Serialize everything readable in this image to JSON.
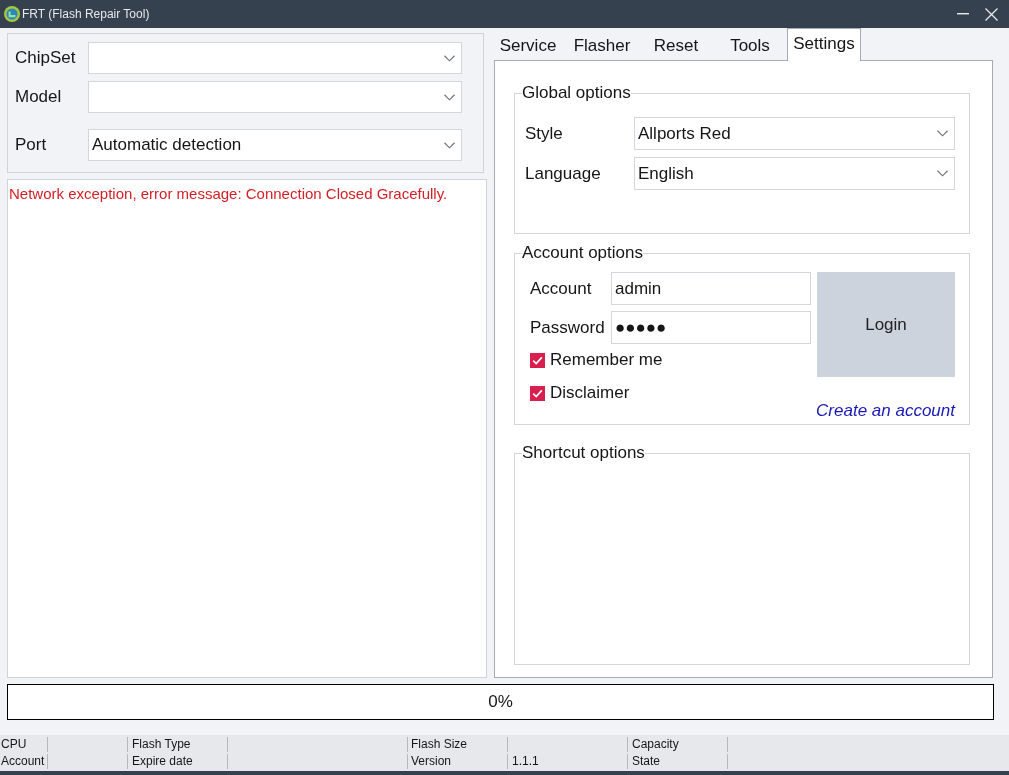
{
  "window": {
    "title": "FRT (Flash Repair Tool)"
  },
  "device": {
    "fields": [
      {
        "label": "ChipSet"
      },
      {
        "label": "Model"
      },
      {
        "label": "Port",
        "value": "Automatic detection"
      }
    ]
  },
  "log": {
    "messages": [
      {
        "kind": "error",
        "text": "Network exception, error message: Connection Closed Gracefully."
      }
    ]
  },
  "tabs": [
    {
      "label": "Service",
      "selected": false
    },
    {
      "label": "Flasher",
      "selected": false
    },
    {
      "label": "Reset",
      "selected": false
    },
    {
      "label": "Tools",
      "selected": false
    },
    {
      "label": "Settings",
      "selected": true
    }
  ],
  "settings": {
    "global_options": {
      "title": "Global options",
      "fields": [
        {
          "label": "Style",
          "value": "Allports Red"
        },
        {
          "label": "Language",
          "value": "English"
        }
      ]
    },
    "account_options": {
      "title": "Account options",
      "fields": [
        {
          "label": "Account",
          "value": "admin"
        },
        {
          "label": "Password",
          "value": "●●●●●"
        }
      ],
      "checkboxes": [
        {
          "label": "Remember me",
          "checked": true
        },
        {
          "label": "Disclaimer",
          "checked": true
        }
      ],
      "login_button": "Login",
      "link": "Create an account"
    },
    "shortcut_options": {
      "title": "Shortcut options"
    }
  },
  "progress": {
    "level": 0,
    "reading": "0%"
  },
  "status_bar": {
    "rows": [
      {
        "fields": [
          {
            "label": "CPU"
          },
          {
            "label": "Flash Type"
          },
          {
            "label": "Flash Size"
          },
          {
            "label": "Capacity"
          }
        ]
      },
      {
        "fields": [
          {
            "label": "Account"
          },
          {
            "label": "Expire date"
          },
          {
            "label": "Version",
            "value": "1.1.1"
          },
          {
            "label": "State"
          }
        ]
      }
    ]
  }
}
